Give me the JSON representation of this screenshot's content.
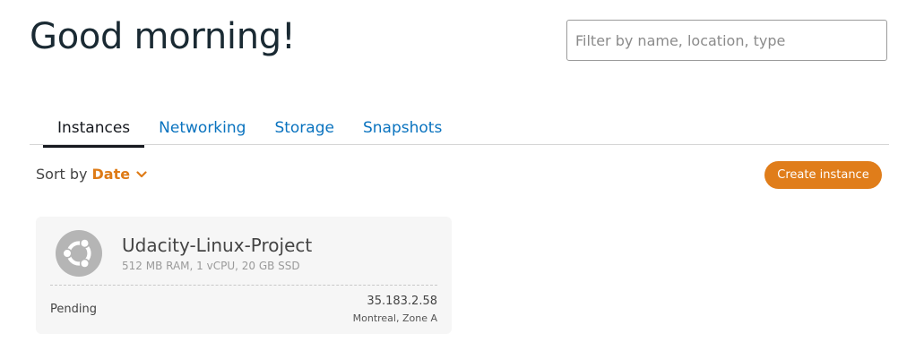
{
  "header": {
    "greeting": "Good morning!",
    "filter_placeholder": "Filter by name, location, type"
  },
  "tabs": [
    {
      "label": "Instances",
      "active": true
    },
    {
      "label": "Networking",
      "active": false
    },
    {
      "label": "Storage",
      "active": false
    },
    {
      "label": "Snapshots",
      "active": false
    }
  ],
  "toolbar": {
    "sort_label": "Sort by",
    "sort_value": "Date",
    "sort_icon": "chevron-down-icon",
    "create_label": "Create instance"
  },
  "instances": [
    {
      "name": "Udacity-Linux-Project",
      "specs": "512 MB RAM, 1 vCPU, 20 GB SSD",
      "status": "Pending",
      "ip": "35.183.2.58",
      "location": "Montreal, Zone A",
      "icon": "ubuntu-icon"
    }
  ],
  "colors": {
    "accent": "#e07d1a",
    "link": "#0a73bf",
    "text": "#16191f"
  }
}
